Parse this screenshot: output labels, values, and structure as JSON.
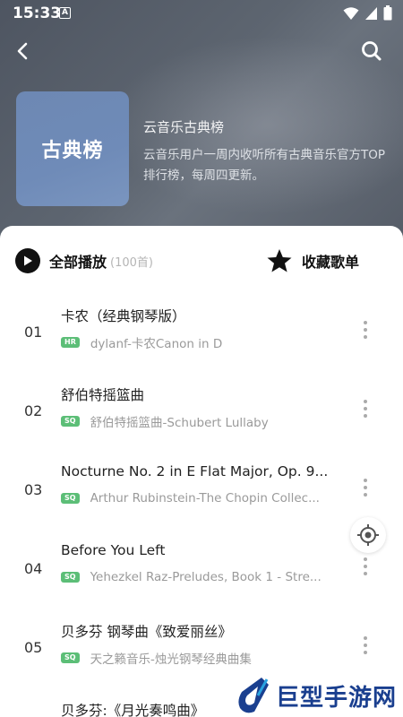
{
  "status_bar": {
    "time": "15:33",
    "notification_letter": "A",
    "icons": [
      "wifi-icon",
      "signal-icon",
      "battery-icon"
    ]
  },
  "nav": {
    "back_icon": "chevron-left-icon",
    "search_icon": "search-icon"
  },
  "playlist": {
    "cover_title": "古典榜",
    "name": "云音乐古典榜",
    "description": "云音乐用户一周内收听所有古典音乐官方TOP排行榜，每周四更新。",
    "cover_color": "#6f8bb8"
  },
  "actions": {
    "play_all_label": "全部播放",
    "play_all_count": "(100首)",
    "collect_label": "收藏歌单"
  },
  "songs": [
    {
      "index": "01",
      "title": "卡农（经典钢琴版）",
      "badge": "HR",
      "artist": "dylanf-卡农Canon in D"
    },
    {
      "index": "02",
      "title": "舒伯特摇篮曲",
      "badge": "SQ",
      "artist": "舒伯特摇篮曲-Schubert Lullaby"
    },
    {
      "index": "03",
      "title": "Nocturne No. 2 in E Flat Major, Op. 9...",
      "badge": "SQ",
      "artist": "Arthur Rubinstein-The Chopin Collec..."
    },
    {
      "index": "04",
      "title": "Before You Left",
      "badge": "SQ",
      "artist": "Yehezkel Raz-Preludes, Book 1 - Stre..."
    },
    {
      "index": "05",
      "title": "贝多芬 钢琴曲《致爱丽丝》",
      "badge": "SQ",
      "artist": "天之籁音乐-烛光钢琴经典曲集"
    },
    {
      "index": "",
      "title": "贝多芬:《月光奏鸣曲》",
      "badge": "",
      "artist": ""
    }
  ],
  "watermark": {
    "text": "巨型手游网"
  },
  "colors": {
    "badge_green": "#5cbe77",
    "watermark_blue": "#1a3f8f"
  }
}
